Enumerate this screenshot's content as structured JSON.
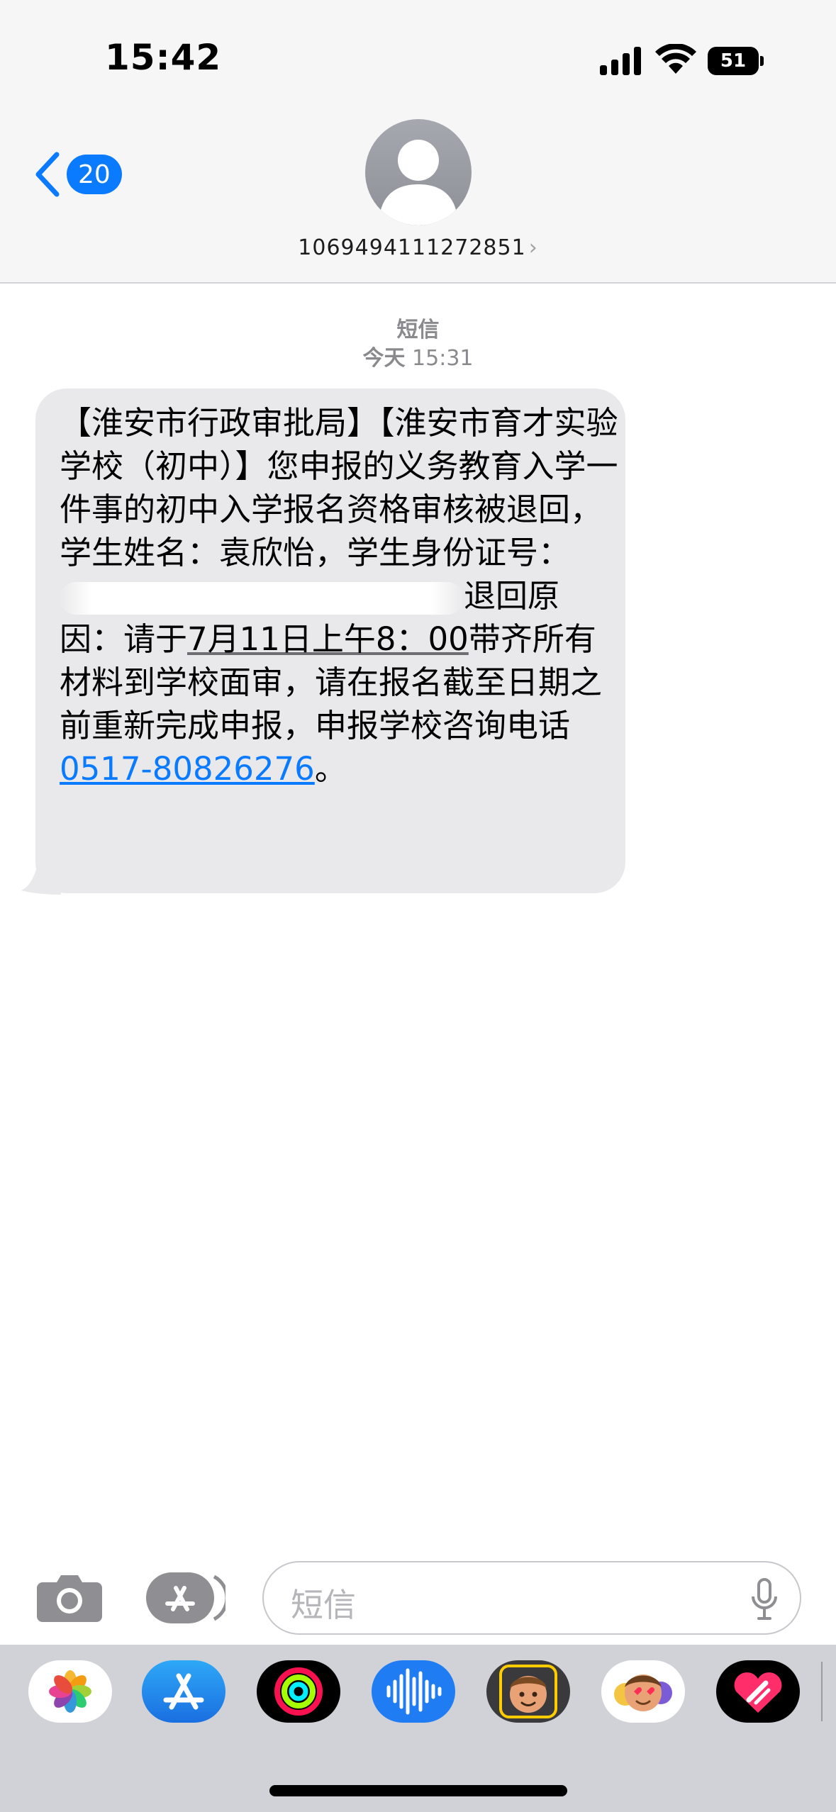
{
  "status_bar": {
    "time": "15:42",
    "battery_level": "51",
    "icons": [
      "cellular-signal-icon",
      "wifi-icon",
      "battery-icon"
    ]
  },
  "nav": {
    "back_icon": "chevron-left-icon",
    "unread_count": "20"
  },
  "contact": {
    "avatar_icon": "person-silhouette-icon",
    "number": "1069494111272851",
    "chevron": "›"
  },
  "conversation": {
    "service_label": "短信",
    "date_prefix": "今天",
    "time": "15:31"
  },
  "message": {
    "text_part1": "【淮安市行政审批局】【淮安市育才实验学校（初中）】您申报的义务教育入学一件事的初中入学报名资格审核被退回，学生姓名：袁欣怡，学生身份证号：",
    "text_part2": "退回原因：请于",
    "date_time": "7月11日上午8：00",
    "text_part3": "带齐所有材料到学校面审，请在报名截至日期之前重新完成申报，申报学校咨询电话",
    "phone": "0517-80826276",
    "text_end": "。"
  },
  "input_bar": {
    "placeholder": "短信",
    "icons": [
      "camera-icon",
      "app-store-icon",
      "microphone-icon"
    ]
  },
  "app_drawer": {
    "apps": [
      "photos-icon",
      "app-store-icon",
      "fitness-icon",
      "audio-message-icon",
      "memoji-icon",
      "animoji-stickers-icon",
      "digital-touch-icon"
    ]
  },
  "colors": {
    "accent": "#0a7aff",
    "bubble": "#e9e9eb",
    "header_bg": "#f6f6f6",
    "drawer_bg": "#d1d2d8"
  }
}
